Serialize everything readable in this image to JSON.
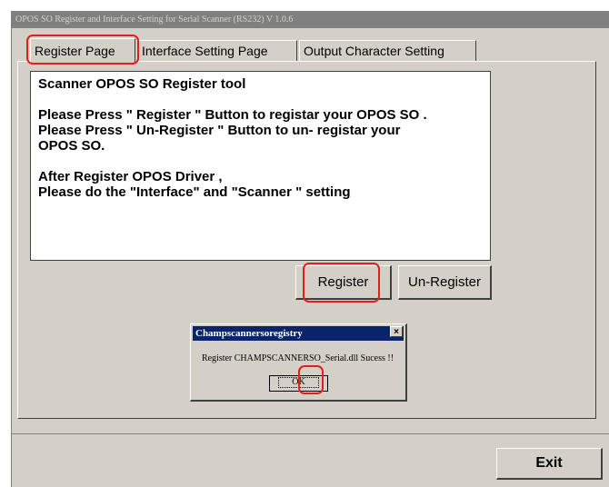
{
  "window": {
    "title": "OPOS SO Register and Interface Setting for Serial Scanner (RS232) V 1.0.6"
  },
  "tabs": [
    {
      "label": "Register Page",
      "active": true
    },
    {
      "label": "Interface Setting Page",
      "active": false
    },
    {
      "label": "Output Character Setting",
      "active": false
    }
  ],
  "info": {
    "lines": [
      "Scanner OPOS SO Register tool",
      "",
      "Please Press \" Register \" Button to registar your OPOS SO .",
      "Please Press \" Un-Register \" Button to un- registar your",
      "OPOS SO.",
      "",
      "After Register OPOS Driver ,",
      "Please do the \"Interface\" and \"Scanner \" setting"
    ]
  },
  "buttons": {
    "register": "Register",
    "unregister": "Un-Register",
    "exit": "Exit"
  },
  "dialog": {
    "title": "Champscannersoregistry",
    "close": "×",
    "message": "Register CHAMPSCANNERSO_Serial.dll Sucess !!",
    "ok": "OK"
  },
  "colors": {
    "highlight": "#e02020",
    "window_bg": "#d4d0c8",
    "dialog_title_bg": "#0a246a"
  }
}
